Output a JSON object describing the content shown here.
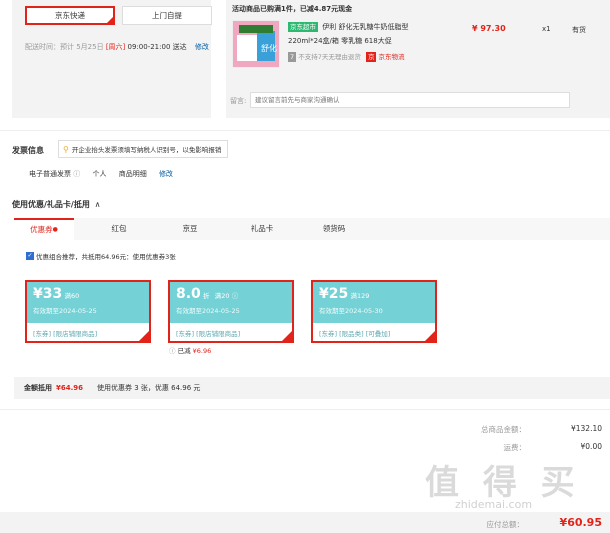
{
  "shipping": {
    "option_selected": "京东快递",
    "option_other": "上门自提",
    "time_label": "配送时间：预计 5月25日",
    "time_day": "[周六]",
    "time_range": "09:00-21:00 送达",
    "modify": "修改"
  },
  "product": {
    "promo": "活动商品已购满1件，已减4.87元现金",
    "badge": "京东超市",
    "name_line1": "伊利 舒化无乳糖牛奶低脂型",
    "name_line2": "220ml*24盒/箱 零乳糖 618大促",
    "no_return": "不支持7天无理由退货",
    "logistics": "京东物流",
    "price": "¥ 97.30",
    "qty": "x1",
    "stock": "有货",
    "image_text": "舒化"
  },
  "note": {
    "label": "留言:",
    "placeholder": "建议留言前先与商家沟通确认"
  },
  "invoice": {
    "title": "发票信息",
    "tip": "开企业抬头发票须填写纳税人识别号，以免影响报销",
    "type": "电子普通发票",
    "person": "个人",
    "detail": "商品明细",
    "modify": "修改"
  },
  "discount": {
    "title": "使用优惠/礼品卡/抵用",
    "arrow": "∧",
    "tabs": [
      "优惠券",
      "红包",
      "京豆",
      "礼品卡",
      "领货码"
    ],
    "combo_text": "优惠组合推荐，共抵用64.96元：使用优惠券3张",
    "coupons": [
      {
        "amount": "¥33",
        "cond": "满60",
        "valid": "有效期至2024-05-25",
        "tags": "[东券]  [限店铺限商品]"
      },
      {
        "amount": "8.0",
        "unit": "折",
        "cond": "满20",
        "valid": "有效期至2024-05-25",
        "tags": "[东券]  [限店铺限商品]",
        "reduced_label": "已减",
        "reduced_value": "¥6.96"
      },
      {
        "amount": "¥25",
        "cond": "满129",
        "valid": "有效期至2024-05-30",
        "tags": "[东券]  [限品类]  [可叠加]"
      }
    ],
    "summary_label": "金额抵用",
    "summary_value": "¥64.96",
    "summary_detail": "使用优惠券 3 张，优惠 64.96 元"
  },
  "totals": {
    "goods_label": "总商品金额：",
    "goods_value": "¥132.10",
    "freight_label": "运费：",
    "freight_value": "¥0.00",
    "pay_label": "应付总额：",
    "pay_value": "¥60.95"
  },
  "watermark": {
    "text": "值 得 买",
    "sub": "zhidemai.com"
  },
  "colors": {
    "accent": "#e2231a",
    "teal": "#74d2d6",
    "link": "#005aa0"
  }
}
